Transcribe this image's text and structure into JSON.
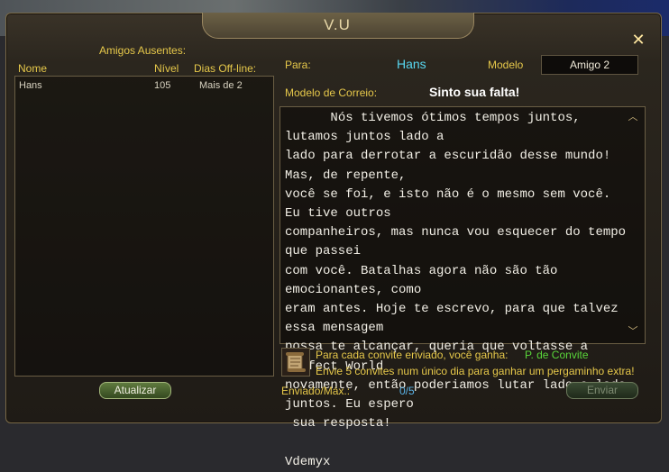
{
  "window": {
    "title": "V.U"
  },
  "left_panel": {
    "section_title": "Amigos Ausentes:",
    "columns": [
      "Nome",
      "Nível",
      "Dias Off-line:"
    ],
    "rows": [
      {
        "name": "Hans",
        "level": "105",
        "days": "Mais de 2"
      }
    ],
    "refresh_label": "Atualizar"
  },
  "form": {
    "to_label": "Para:",
    "to_value": "Hans",
    "model_label": "Modelo",
    "model_value": "Amigo 2",
    "mail_model_label": "Modelo de Correio:",
    "mail_model_value": "Sinto sua falta!",
    "letter_text": "      Nós tivemos ótimos tempos juntos, lutamos juntos lado a\nlado para derrotar a escuridão desse mundo! Mas, de repente,\nvocê se foi, e isto não é o mesmo sem você. Eu tive outros\ncompanheiros, mas nunca vou esquecer do tempo que passei\ncom você. Batalhas agora não são tão emocionantes, como\neram antes. Hoje te escrevo, para que talvez essa mensagem\npossa te alcançar, queria que voltasse a Perfect World\nnovamente, então poderiamos lutar lado a lado juntos. Eu espero\n sua resposta!\n                                            Vdemyx"
  },
  "reward": {
    "line1": "Para cada convite enviado, você ganha:",
    "points_label": "P. de Convite",
    "line2": "Envie 5 convites num único dia para ganhar um pergaminho extra!"
  },
  "footer": {
    "sent_label": "Enviado/Máx.:",
    "sent_value": "0/5",
    "send_label": "Enviar"
  },
  "icons": {
    "close": "close-icon",
    "scroll_up": "chevron-up-icon",
    "scroll_down": "chevron-down-icon",
    "reward": "scroll-icon"
  },
  "colors": {
    "label_yellow": "#e6c84a",
    "name_cyan": "#58d6f0",
    "points_green": "#59d63a"
  }
}
